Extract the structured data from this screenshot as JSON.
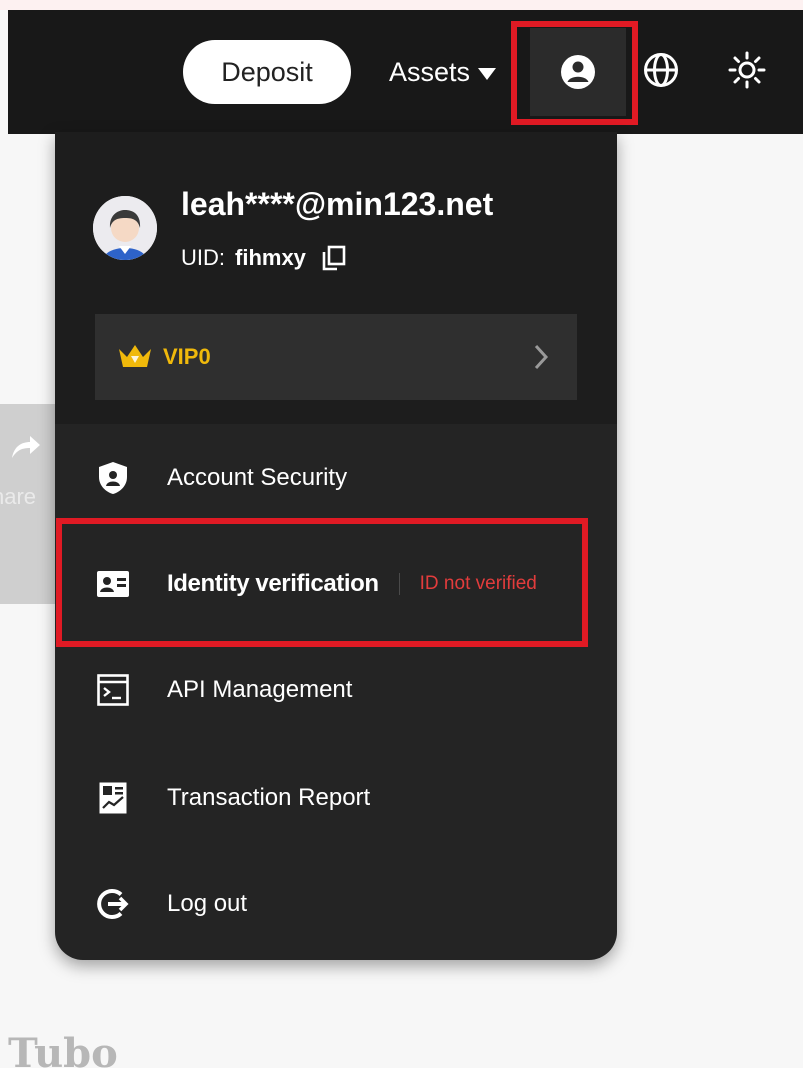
{
  "header": {
    "deposit_label": "Deposit",
    "assets_label": "Assets"
  },
  "profile": {
    "email": "leah****@min123.net",
    "uid_label": "UID:",
    "uid_value": "fihmxy",
    "vip_label": "VIP0"
  },
  "menu": {
    "items": [
      {
        "label": "Account Security",
        "icon": "shield-icon"
      },
      {
        "label": "Identity verification",
        "icon": "id-card-icon",
        "status": "ID not verified"
      },
      {
        "label": "API Management",
        "icon": "terminal-icon"
      },
      {
        "label": "Transaction Report",
        "icon": "report-icon"
      },
      {
        "label": "Log out",
        "icon": "logout-icon"
      }
    ]
  },
  "background": {
    "share_label": "hare",
    "bottom_text": "Tubo"
  },
  "colors": {
    "topbar": "#181818",
    "dropdown": "#242424",
    "highlight": "#e01a24",
    "vip": "#f0b90b",
    "status_red": "#e23c3c"
  }
}
